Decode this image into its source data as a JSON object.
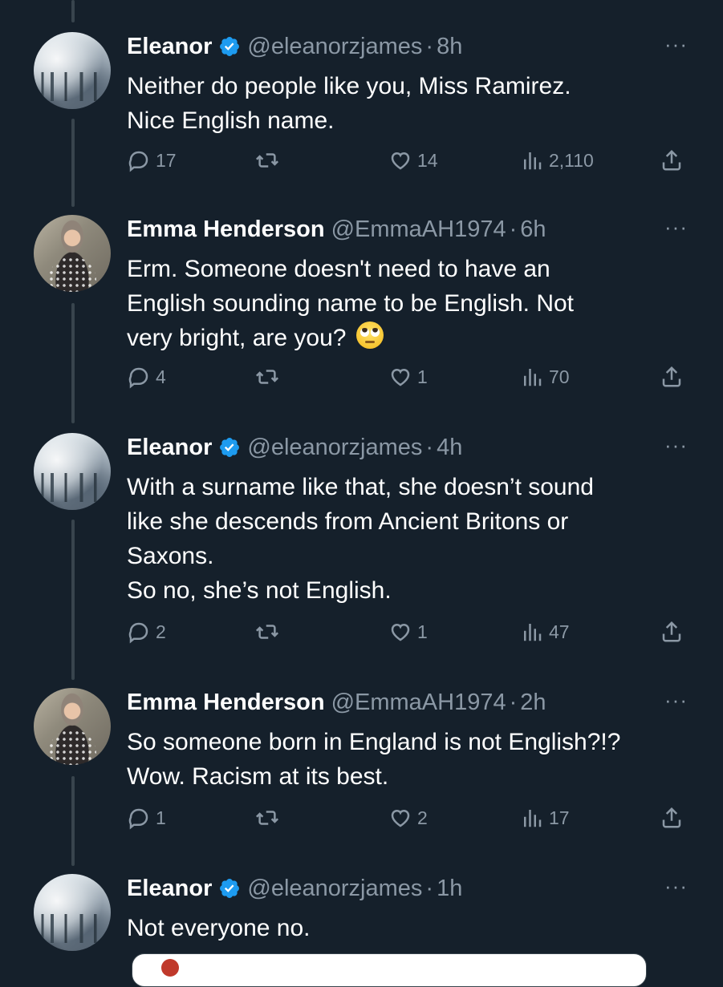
{
  "tweets": [
    {
      "author": "Eleanor",
      "verified": true,
      "handle": "@eleanorzjames",
      "time": "8h",
      "lines": [
        "Neither do people like you, Miss Ramirez.",
        "Nice English name."
      ],
      "replies": "17",
      "reposts": "",
      "likes": "14",
      "views": "2,110"
    },
    {
      "author": "Emma Henderson",
      "verified": false,
      "handle": "@EmmaAH1974",
      "time": "6h",
      "lines": [
        "Erm. Someone doesn't need to have an",
        "English sounding name to be English. Not",
        "very bright, are you?"
      ],
      "emoji": "face-with-rolling-eyes",
      "replies": "4",
      "reposts": "",
      "likes": "1",
      "views": "70"
    },
    {
      "author": "Eleanor",
      "verified": true,
      "handle": "@eleanorzjames",
      "time": "4h",
      "lines": [
        "With a surname like that, she doesn’t sound",
        "like she descends from Ancient Britons or",
        "Saxons.",
        "So no, she’s not English."
      ],
      "replies": "2",
      "reposts": "",
      "likes": "1",
      "views": "47"
    },
    {
      "author": "Emma Henderson",
      "verified": false,
      "handle": "@EmmaAH1974",
      "time": "2h",
      "lines": [
        "So someone born in England is not English?!?",
        "Wow. Racism at its best."
      ],
      "replies": "1",
      "reposts": "",
      "likes": "2",
      "views": "17"
    },
    {
      "author": "Eleanor",
      "verified": true,
      "handle": "@eleanorzjames",
      "time": "1h",
      "lines": [
        "Not everyone no."
      ]
    }
  ],
  "icons": {
    "more": "more-horizontal-icon",
    "reply": "reply-icon",
    "repost": "repost-icon",
    "like": "heart-icon",
    "views": "views-icon",
    "share": "share-icon",
    "verified": "verified-badge-icon"
  },
  "colors": {
    "background": "#15202b",
    "muted": "#8b98a5",
    "verified": "#1d9bf0",
    "thread_line": "#38444d"
  },
  "separator": "·",
  "more_glyph": "···"
}
